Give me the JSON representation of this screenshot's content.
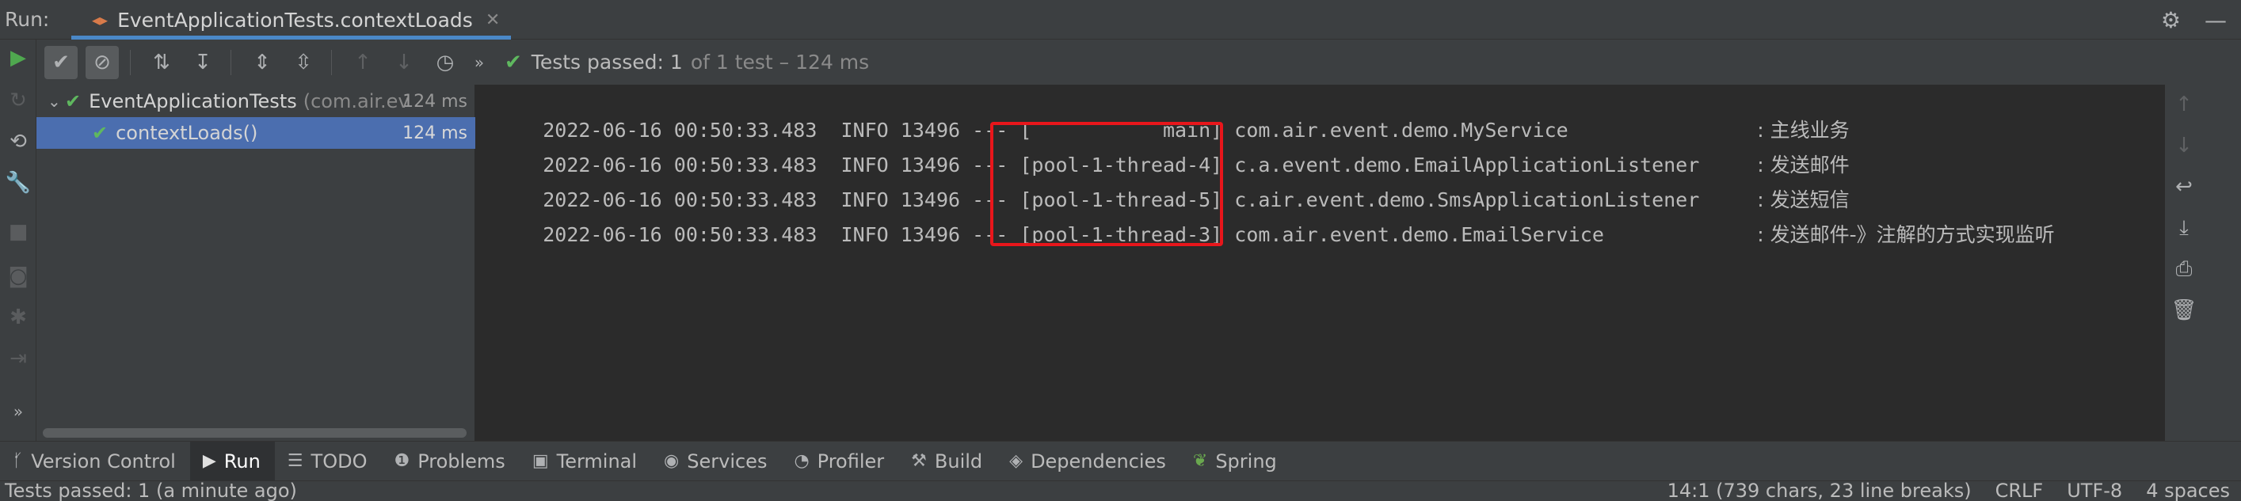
{
  "titlebar": {
    "run_label": "Run:",
    "tab_label": "EventApplicationTests.contextLoads",
    "settings_icon": "gear-icon",
    "minimize_icon": "minimize-icon"
  },
  "test_toolbar": {
    "status_text": "Tests passed:",
    "status_count": "1",
    "status_detail": "of 1 test – 124 ms"
  },
  "tree": {
    "items": [
      {
        "name": "EventApplicationTests",
        "package": "(com.air.ev",
        "time": "124 ms"
      },
      {
        "name": "contextLoads()",
        "time": "124 ms"
      }
    ]
  },
  "console": {
    "lines": [
      {
        "timestamp": "2022-06-16 00:50:33.483",
        "level": "INFO",
        "pid": "13496",
        "sep": "---",
        "thread": "[           main]",
        "logger": "com.air.event.demo.MyService",
        "message": ": 主线业务"
      },
      {
        "timestamp": "2022-06-16 00:50:33.483",
        "level": "INFO",
        "pid": "13496",
        "sep": "---",
        "thread": "[pool-1-thread-4]",
        "logger": "c.a.event.demo.EmailApplicationListener",
        "message": ": 发送邮件"
      },
      {
        "timestamp": "2022-06-16 00:50:33.483",
        "level": "INFO",
        "pid": "13496",
        "sep": "---",
        "thread": "[pool-1-thread-5]",
        "logger": "c.air.event.demo.SmsApplicationListener",
        "message": ": 发送短信"
      },
      {
        "timestamp": "2022-06-16 00:50:33.483",
        "level": "INFO",
        "pid": "13496",
        "sep": "---",
        "thread": "[pool-1-thread-3]",
        "logger": "com.air.event.demo.EmailService",
        "message": ": 发送邮件-》注解的方式实现监听"
      }
    ],
    "highlight_color": "#e8161b"
  },
  "tool_bar": {
    "items": [
      {
        "label": "Version Control",
        "icon": "branch-icon"
      },
      {
        "label": "Run",
        "icon": "play-icon"
      },
      {
        "label": "TODO",
        "icon": "list-icon"
      },
      {
        "label": "Problems",
        "icon": "info-icon"
      },
      {
        "label": "Terminal",
        "icon": "terminal-icon"
      },
      {
        "label": "Services",
        "icon": "services-icon"
      },
      {
        "label": "Profiler",
        "icon": "profiler-icon"
      },
      {
        "label": "Build",
        "icon": "hammer-icon"
      },
      {
        "label": "Dependencies",
        "icon": "layers-icon"
      },
      {
        "label": "Spring",
        "icon": "leaf-icon"
      }
    ]
  },
  "status_bar": {
    "left_text": "Tests passed: 1 (a minute ago)",
    "position": "14:1 (739 chars, 23 line breaks)",
    "line_separator": "CRLF",
    "encoding": "UTF-8",
    "indent": "4 spaces"
  },
  "colors": {
    "accent_blue": "#4a88c7",
    "selection": "#4b6eaf",
    "success_green": "#5fb85f",
    "run_green": "#4fa84f"
  }
}
